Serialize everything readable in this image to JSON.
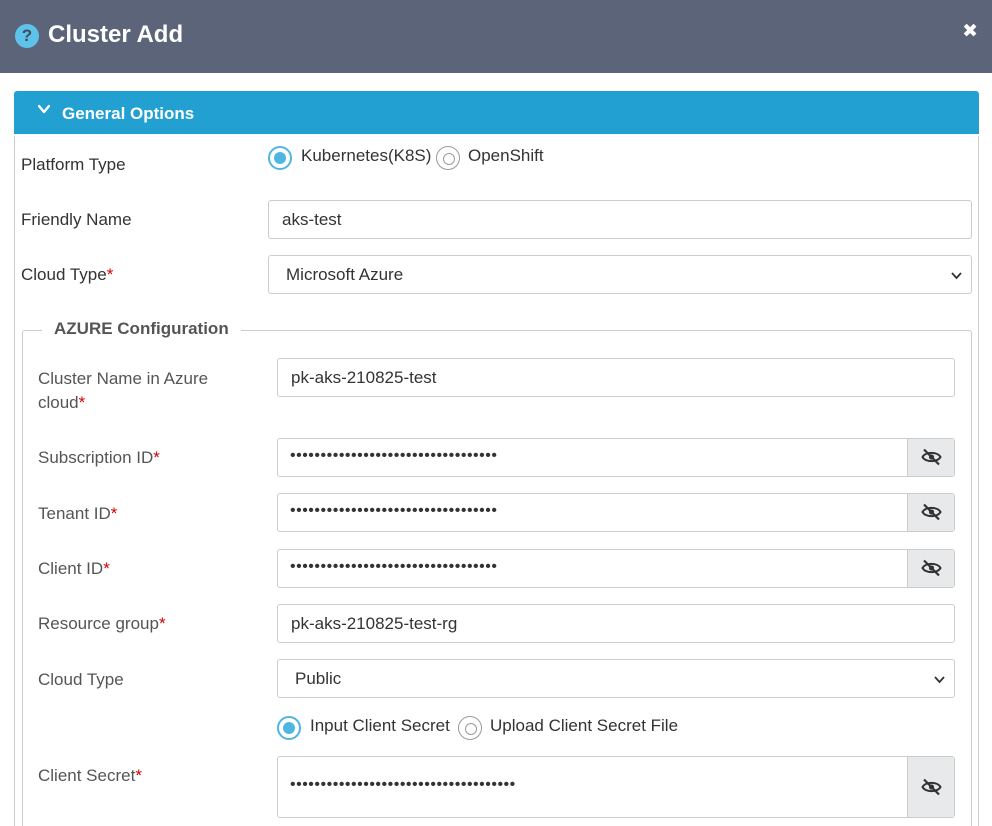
{
  "dialog": {
    "title": "Cluster Add",
    "help_icon": "question-circle-icon",
    "close_icon": "close-icon",
    "close_glyph": "✖"
  },
  "section": {
    "title": "General Options",
    "icon": "chevron-down-icon"
  },
  "general": {
    "platform_type_label": "Platform Type",
    "platform_options": [
      {
        "label": "Kubernetes(K8S)",
        "selected": true
      },
      {
        "label": "OpenShift",
        "selected": false
      }
    ],
    "friendly_name_label": "Friendly Name",
    "friendly_name_value": "aks-test",
    "cloud_type_label": "Cloud Type",
    "cloud_type_value": "Microsoft Azure",
    "required_mark": "*"
  },
  "azure": {
    "legend": "AZURE Configuration",
    "cluster_name_label_1": "Cluster Name in Azure",
    "cluster_name_label_2": "cloud",
    "cluster_name_value": "pk-aks-210825-test",
    "subscription_label": "Subscription ID",
    "subscription_value": "••••••••••••••••••••••••••••••••••",
    "tenant_label": "Tenant ID",
    "tenant_value": "••••••••••••••••••••••••••••••••••",
    "client_id_label": "Client ID",
    "client_id_value": "••••••••••••••••••••••••••••••••••",
    "resource_group_label": "Resource group",
    "resource_group_value": "pk-aks-210825-test-rg",
    "cloud_type_label": "Cloud Type",
    "cloud_type_value": "Public",
    "secret_options": [
      {
        "label": "Input Client Secret",
        "selected": true
      },
      {
        "label": "Upload Client Secret File",
        "selected": false
      }
    ],
    "client_secret_label": "Client Secret",
    "client_secret_value": "•••••••••••••••••••••••••••••••••••••",
    "eye_icon": "eye-slash-icon"
  },
  "colors": {
    "titlebar": "#5b6478",
    "section_bar": "#22a0d2",
    "radio_accent": "#4fb6e0",
    "required": "#d00000"
  }
}
